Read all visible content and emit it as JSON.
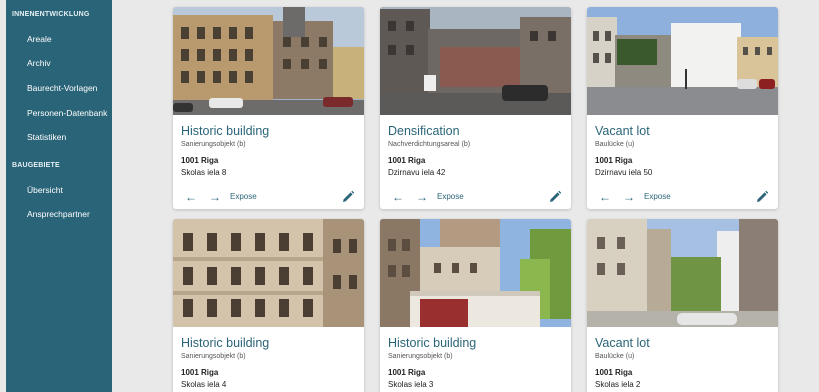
{
  "sidebar": {
    "sections": [
      {
        "label": "INNENENTWICKLUNG",
        "items": [
          "Areale",
          "Archiv",
          "Baurecht-Vorlagen",
          "Personen-Datenbank",
          "Statistiken"
        ]
      },
      {
        "label": "BAUGEBIETE",
        "items": [
          "Übersicht",
          "Ansprechpartner"
        ]
      }
    ]
  },
  "cards": [
    {
      "title": "Historic building",
      "subtitle": "Sanierungsobjekt (b)",
      "city": "1001 Riga",
      "street": "Skolas iela 8",
      "expose": "Expose"
    },
    {
      "title": "Densification",
      "subtitle": "Nachverdichtungsareal (b)",
      "city": "1001 Riga",
      "street": "Dzirnavu iela 42",
      "expose": "Expose"
    },
    {
      "title": "Vacant lot",
      "subtitle": "Baulücke (u)",
      "city": "1001 Riga",
      "street": "Dzirnavu iela 50",
      "expose": "Expose"
    },
    {
      "title": "Historic building",
      "subtitle": "Sanierungsobjekt (b)",
      "city": "1001 Riga",
      "street": "Skolas iela 4"
    },
    {
      "title": "Historic building",
      "subtitle": "Sanierungsobjekt (b)",
      "city": "1001 Riga",
      "street": "Skolas iela 3"
    },
    {
      "title": "Vacant lot",
      "subtitle": "Baulücke (u)",
      "city": "1001 Riga",
      "street": "Skolas iela 2"
    }
  ],
  "icons": {
    "prev": "arrow-left-icon",
    "next": "arrow-right-icon",
    "edit": "pencil-icon"
  },
  "colors": {
    "sidebar": "#2a6478",
    "accent": "#2a6478",
    "background": "#e9e9e9"
  }
}
